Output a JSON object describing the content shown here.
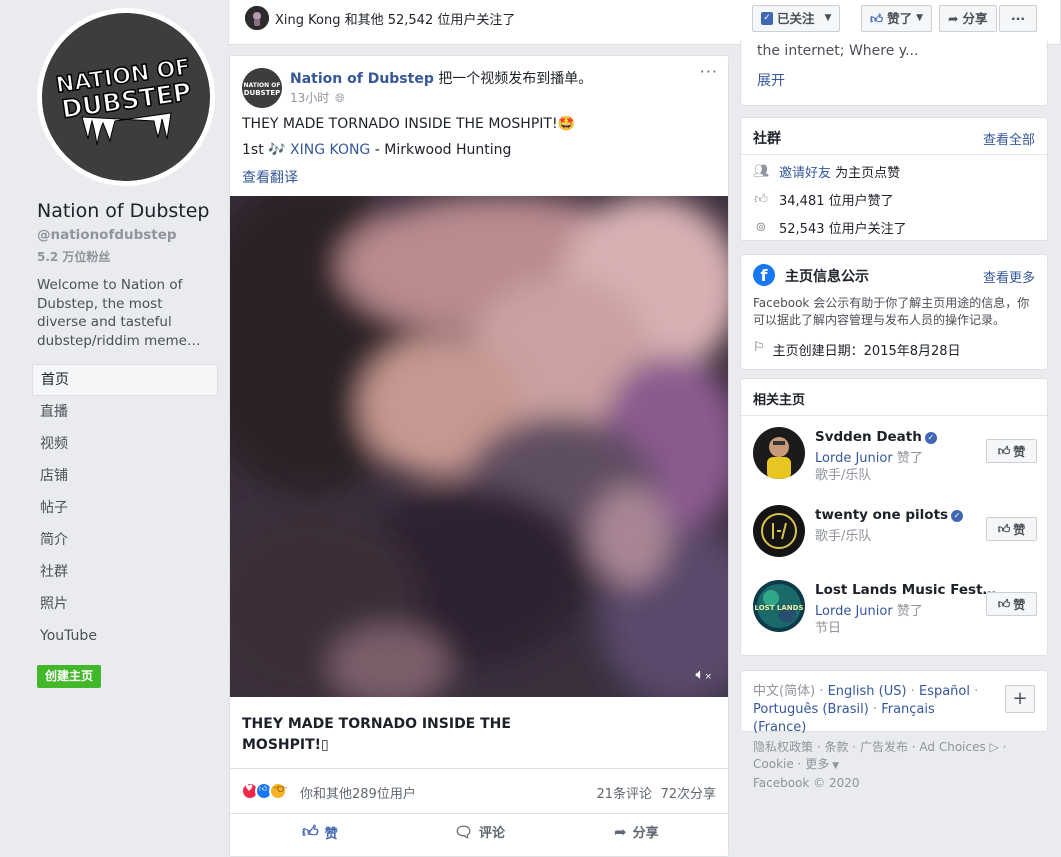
{
  "left": {
    "page_name": "Nation of Dubstep",
    "handle": "@nationofdubstep",
    "fans": "5.2 万位粉丝",
    "description": "Welcome to Nation of Dubstep, the most diverse and tasteful dubstep/riddim meme…",
    "logo_text_1": "NATION OF",
    "logo_text_2": "DUBSTEP",
    "nav": [
      "首页",
      "直播",
      "视频",
      "店铺",
      "帖子",
      "简介",
      "社群",
      "照片",
      "YouTube"
    ],
    "create_page": "创建主页"
  },
  "topbar": {
    "follow_text": "Xing Kong 和其他 52,542 位用户关注了",
    "following_label": "已关注",
    "liked_label": "赞了",
    "share_label": "分享",
    "more_label": "···"
  },
  "post": {
    "author": "Nation of Dubstep",
    "action": "把一个视频发布到播单。",
    "time": "13小时",
    "text1": "THEY MADE TORNADO INSIDE THE MOSHPIT!🤩",
    "text2_prefix": "1st 🎶 ",
    "text2_link": "XING KONG",
    "text2_suffix": " - Mirkwood Hunting",
    "see_translation": "查看翻译",
    "video_caption": "THEY MADE TORNADO INSIDE THE MOSHPIT!▯",
    "reactions_text": "你和其他289位用户",
    "comments": "21条评论",
    "shares": "72次分享",
    "like_action": "赞",
    "comment_action": "评论",
    "share_action": "分享",
    "more": "···"
  },
  "about": {
    "text": "the internet; Where y...",
    "expand": "展开"
  },
  "community": {
    "title": "社群",
    "see_all": "查看全部",
    "invite_link": "邀请好友",
    "invite_suffix": " 为主页点赞",
    "likes": "34,481 位用户赞了",
    "follows": "52,543 位用户关注了"
  },
  "transparency": {
    "title": "主页信息公示",
    "see_more": "查看更多",
    "desc": "Facebook 会公示有助于你了解主页用途的信息，你可以据此了解内容管理与发布人员的操作记录。",
    "created": "主页创建日期：2015年8月28日"
  },
  "related": {
    "title": "相关主页",
    "items": [
      {
        "name": "Svdden Death",
        "verified": true,
        "sub_name": "Lorde Junior",
        "sub_action": " 赞了",
        "category": "歌手/乐队",
        "like": "赞"
      },
      {
        "name": "twenty one pilots",
        "verified": true,
        "sub_name": "",
        "sub_action": "",
        "category": "歌手/乐队",
        "like": "赞"
      },
      {
        "name": "Lost Lands Music Fest…",
        "verified": false,
        "sub_name": "Lorde Junior",
        "sub_action": " 赞了",
        "category": "节日",
        "like": "赞"
      }
    ],
    "lost_lands_logo": "LOST LANDS"
  },
  "languages": {
    "current": "中文(简体)",
    "items": [
      "English (US)",
      "Español",
      "Português (Brasil)",
      "Français (France)"
    ],
    "plus": "+"
  },
  "footer": {
    "links": [
      "隐私权政策",
      "条款",
      "广告发布",
      "Ad Choices",
      "Cookie",
      "更多"
    ],
    "copyright": "Facebook © 2020"
  },
  "colors": {
    "fb_blue": "#365899",
    "green": "#42b72a",
    "background": "#e9ebee"
  }
}
